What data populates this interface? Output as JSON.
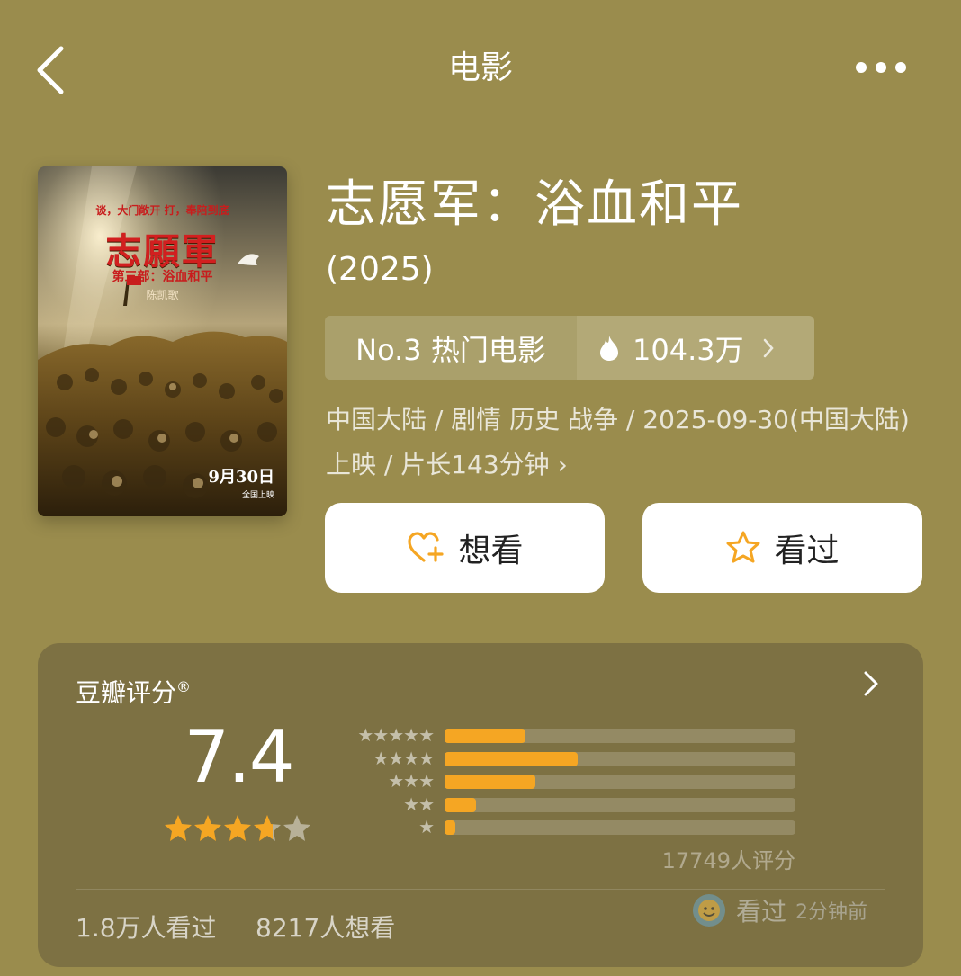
{
  "header": {
    "title": "电影"
  },
  "poster": {
    "tagline": "谈，大门敞开 打，奉陪到底",
    "title": "志願軍",
    "subtitle": "第三部：浴血和平",
    "director": "陈凯歌",
    "release_date": "9月30日",
    "release_sub": "全国上映"
  },
  "movie": {
    "title": "志愿军：浴血和平",
    "year": "(2025)",
    "rank_label": "No.3 热门电影",
    "heat_value": "104.3万",
    "meta": "中国大陆 / 剧情 历史 战争 / 2025-09-30(中国大陆)上映 / 片长143分钟 ›"
  },
  "actions": {
    "want_label": "想看",
    "seen_label": "看过"
  },
  "rating": {
    "label": "豆瓣评分",
    "mark": "®",
    "score": "7.4",
    "star_value": 3.7,
    "star_max": 5,
    "distribution": [
      {
        "stars": "★★★★★",
        "fraction": 0.23
      },
      {
        "stars": "★★★★",
        "fraction": 0.38
      },
      {
        "stars": "★★★",
        "fraction": 0.26
      },
      {
        "stars": "★★",
        "fraction": 0.09
      },
      {
        "stars": "★",
        "fraction": 0.03
      }
    ],
    "votes": "17749人评分",
    "seen_count": "1.8万人看过",
    "want_count": "8217人想看",
    "recent_label": "看过",
    "recent_time": "2分钟前"
  },
  "colors": {
    "background": "#9a8c4d",
    "card": "#7d7143",
    "accent": "#f5a623",
    "button_bg": "#ffffff"
  }
}
